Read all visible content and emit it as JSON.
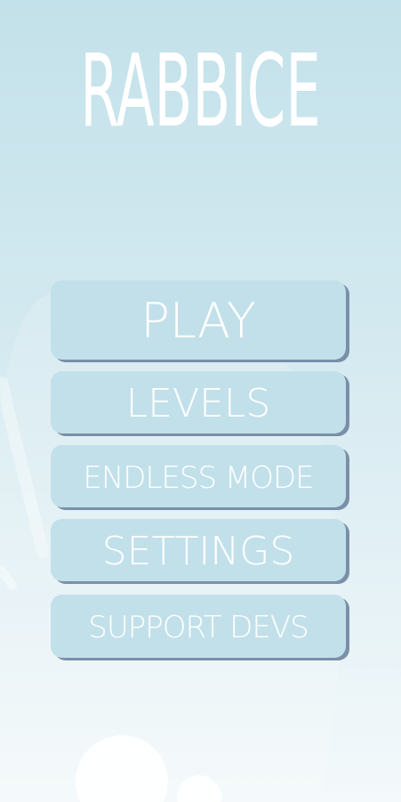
{
  "game": {
    "title": "RABBICE"
  },
  "menu": {
    "play": "PLAY",
    "levels": "LEVELS",
    "endless_mode": "ENDLESS MODE",
    "settings": "SETTINGS",
    "support_devs": "SUPPORT DEVS"
  },
  "colors": {
    "background_top": "#c3e1ea",
    "background_bottom": "#f4f9fb",
    "button_fill": "#c2e0ea",
    "button_shadow": "#7a8fa8",
    "text": "#ffffff"
  }
}
